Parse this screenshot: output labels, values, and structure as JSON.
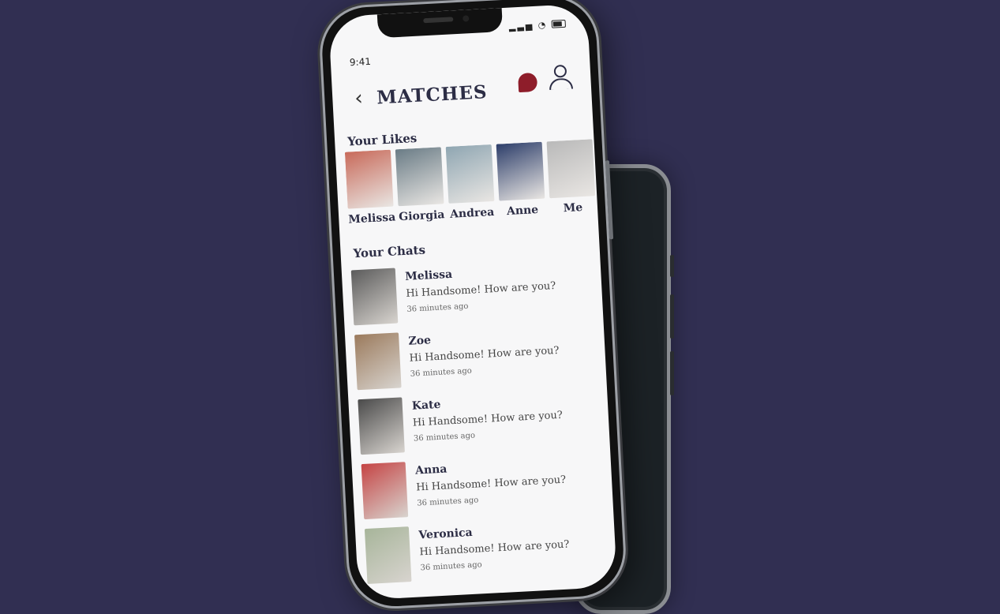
{
  "status_bar": {
    "time": "9:41"
  },
  "header": {
    "title": "MATCHES"
  },
  "likes": {
    "label": "Your Likes",
    "items": [
      {
        "name": "Melissa",
        "color": "#c86a5a"
      },
      {
        "name": "Giorgia",
        "color": "#6a7c86"
      },
      {
        "name": "Andrea",
        "color": "#8fa6b2"
      },
      {
        "name": "Anne",
        "color": "#2d3e6a"
      },
      {
        "name": "Me",
        "color": "#b9b9b9"
      }
    ]
  },
  "chats": {
    "label": "Your Chats",
    "items": [
      {
        "name": "Melissa",
        "message": "Hi Handsome! How are you?",
        "time": "36 minutes ago",
        "color": "#5b5b5b"
      },
      {
        "name": "Zoe",
        "message": "Hi Handsome! How are you?",
        "time": "36 minutes ago",
        "color": "#9b7a5c"
      },
      {
        "name": "Kate",
        "message": "Hi Handsome! How are you?",
        "time": "36 minutes ago",
        "color": "#4a4a4a"
      },
      {
        "name": "Anna",
        "message": "Hi Handsome! How are you?",
        "time": "36 minutes ago",
        "color": "#c54444"
      },
      {
        "name": "Veronica",
        "message": "Hi Handsome! How are you?",
        "time": "36 minutes ago",
        "color": "#a7b59a"
      }
    ]
  }
}
